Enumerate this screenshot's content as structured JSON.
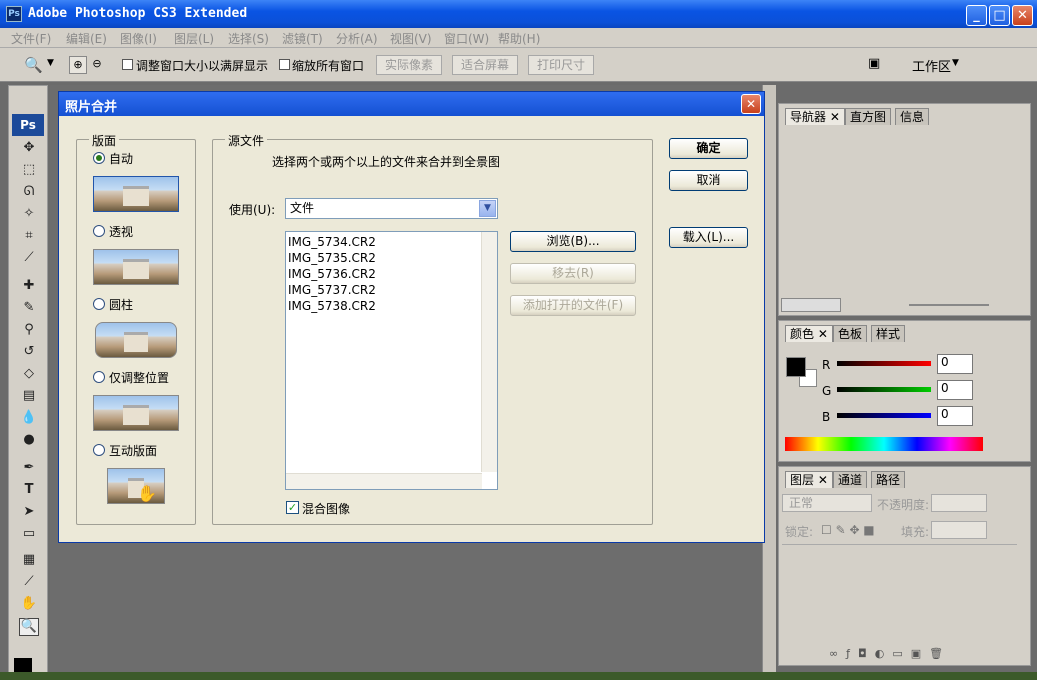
{
  "app": {
    "title": "Adobe Photoshop CS3 Extended",
    "ps_logo": "Ps"
  },
  "menu": [
    "文件(F)",
    "编辑(E)",
    "图像(I)",
    "图层(L)",
    "选择(S)",
    "滤镜(T)",
    "分析(A)",
    "视图(V)",
    "窗口(W)",
    "帮助(H)"
  ],
  "options": {
    "resize_label": "调整窗口大小以满屏显示",
    "zoom_all_label": "缩放所有窗口",
    "actual_pixels": "实际像素",
    "fit_screen": "适合屏幕",
    "print_size": "打印尺寸",
    "workspace": "工作区"
  },
  "dialog": {
    "title": "照片合并",
    "layout_legend": "版面",
    "layouts": [
      {
        "label": "自动",
        "selected": true
      },
      {
        "label": "透视",
        "selected": false
      },
      {
        "label": "圆柱",
        "selected": false
      },
      {
        "label": "仅调整位置",
        "selected": false
      },
      {
        "label": "互动版面",
        "selected": false
      }
    ],
    "source_legend": "源文件",
    "source_hint": "选择两个或两个以上的文件来合并到全景图",
    "use_label": "使用(U):",
    "use_value": "文件",
    "files": [
      "IMG_5734.CR2",
      "IMG_5735.CR2",
      "IMG_5736.CR2",
      "IMG_5737.CR2",
      "IMG_5738.CR2"
    ],
    "browse": "浏览(B)...",
    "remove": "移去(R)",
    "add_open": "添加打开的文件(F)",
    "blend_label": "混合图像",
    "blend_checked": true,
    "ok": "确定",
    "cancel": "取消",
    "load": "载入(L)..."
  },
  "panels": {
    "nav_tabs": [
      "导航器",
      "直方图",
      "信息"
    ],
    "color_tabs": [
      "颜色",
      "色板",
      "样式"
    ],
    "rgb": [
      {
        "ch": "R",
        "value": "0",
        "color": "#cc0000"
      },
      {
        "ch": "G",
        "value": "0",
        "color": "#00aa00"
      },
      {
        "ch": "B",
        "value": "0",
        "color": "#0000cc"
      }
    ],
    "layer_tabs": [
      "图层",
      "通道",
      "路径"
    ],
    "blend_mode": "正常",
    "opacity_label": "不透明度:",
    "lock_label": "锁定:",
    "fill_label": "填充:"
  }
}
